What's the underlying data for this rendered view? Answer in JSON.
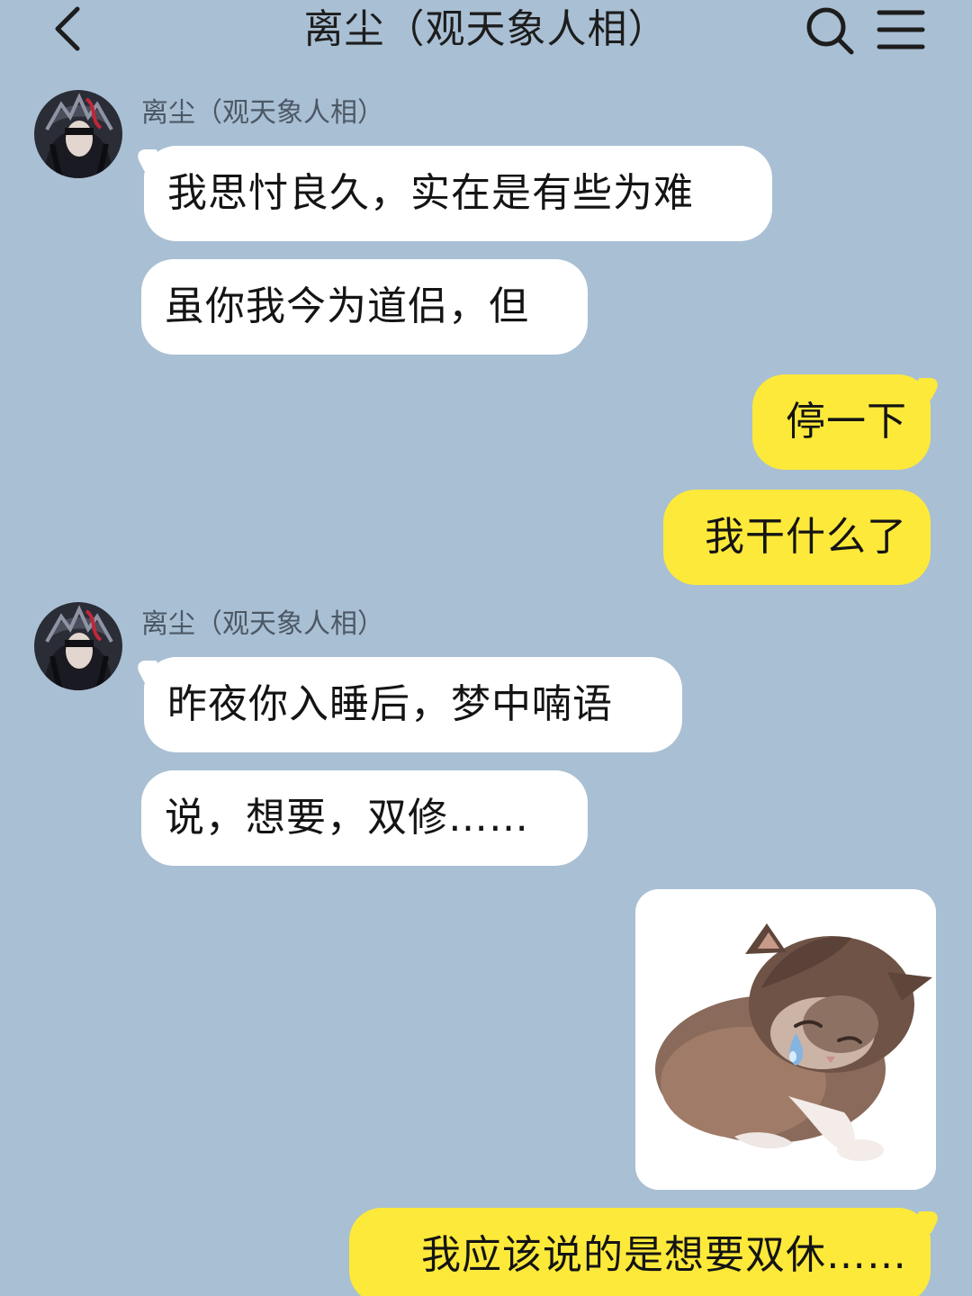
{
  "header": {
    "title": "离尘（观天象人相）",
    "back_icon": "chevron-left-icon",
    "search_icon": "search-icon",
    "menu_icon": "menu-icon"
  },
  "messages": [
    {
      "sender": "离尘（观天象人相）",
      "direction": "incoming",
      "text": "我思忖良久，实在是有些为难"
    },
    {
      "direction": "incoming",
      "text": "虽你我今为道侣，但"
    },
    {
      "direction": "outgoing",
      "text": "停一下"
    },
    {
      "direction": "outgoing",
      "text": "我干什么了"
    },
    {
      "sender": "离尘（观天象人相）",
      "direction": "incoming",
      "text": "昨夜你入睡后，梦中喃语"
    },
    {
      "direction": "incoming",
      "text": "说，想要，双修……"
    },
    {
      "direction": "outgoing",
      "type": "sticker",
      "sticker": "crying-kitten"
    },
    {
      "direction": "outgoing",
      "text": "我应该说的是想要双休……"
    }
  ],
  "colors": {
    "background": "#a9bfd3",
    "incoming_bubble": "#ffffff",
    "outgoing_bubble": "#fde93a",
    "text": "#141414",
    "sender_name": "#4c5866"
  }
}
